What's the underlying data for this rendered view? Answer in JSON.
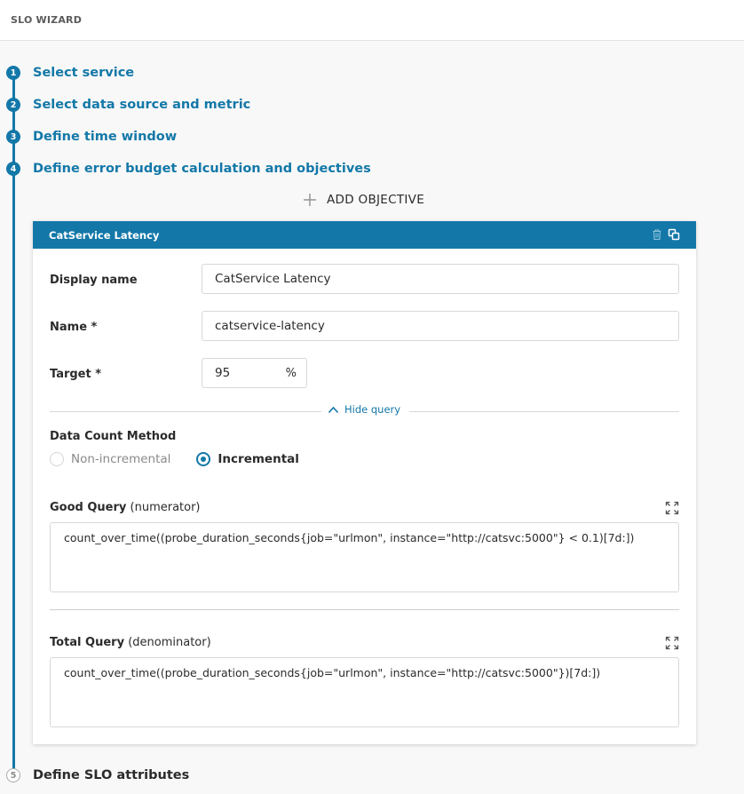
{
  "header": {
    "title": "SLO WIZARD"
  },
  "steps": [
    {
      "number": "1",
      "label": "Select service",
      "state": "completed"
    },
    {
      "number": "2",
      "label": "Select data source and metric",
      "state": "completed"
    },
    {
      "number": "3",
      "label": "Define time window",
      "state": "completed"
    },
    {
      "number": "4",
      "label": "Define error budget calculation and objectives",
      "state": "active"
    },
    {
      "number": "5",
      "label": "Define SLO attributes",
      "state": "inactive"
    }
  ],
  "add_objective": {
    "icon": "plus-icon",
    "label": "ADD OBJECTIVE"
  },
  "objective": {
    "title": "CatService Latency",
    "icons": [
      "trash-icon",
      "copy-icon"
    ],
    "display_name": {
      "label": "Display name",
      "value": "CatService Latency"
    },
    "name": {
      "label": "Name *",
      "value": "catservice-latency"
    },
    "target": {
      "label": "Target *",
      "value": "95",
      "unit": "%"
    },
    "hide_query": {
      "icon": "chevron-up-icon",
      "label": "Hide query"
    },
    "data_count_method": {
      "label": "Data Count Method",
      "options": [
        "Non-incremental",
        "Incremental"
      ],
      "selected": "Incremental"
    },
    "good_query": {
      "label": "Good Query",
      "sublabel": "(numerator)",
      "value": "count_over_time((probe_duration_seconds{job=\"urlmon\", instance=\"http://catsvc:5000\"} < 0.1)[7d:])"
    },
    "total_query": {
      "label": "Total Query",
      "sublabel": "(denominator)",
      "value": "count_over_time((probe_duration_seconds{job=\"urlmon\", instance=\"http://catsvc:5000\"})[7d:])"
    }
  },
  "colors": {
    "accent": "#1378a8",
    "border": "#d8d8d8",
    "background": "#f8f8f8"
  }
}
